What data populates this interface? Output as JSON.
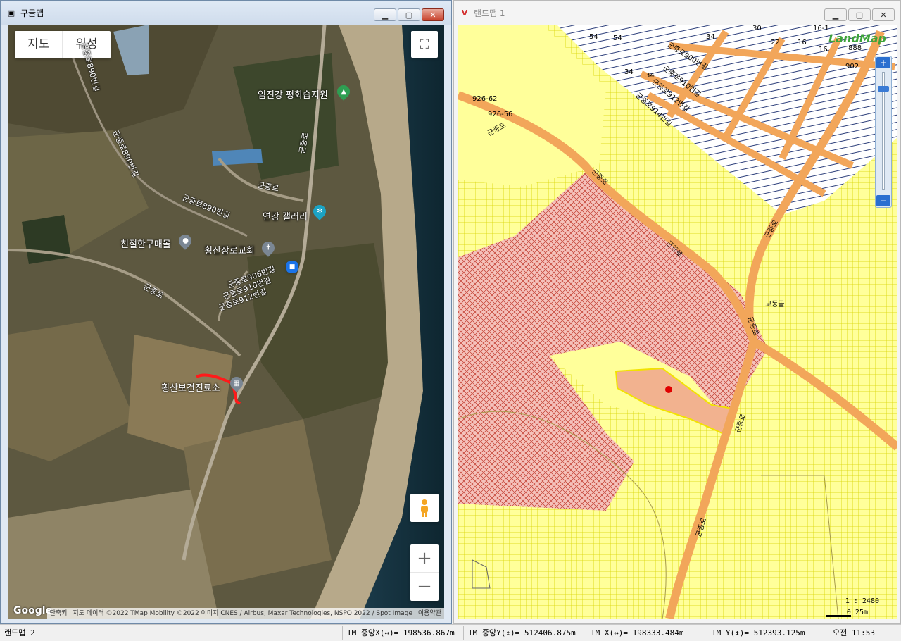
{
  "left_window": {
    "title": "구글맵",
    "controls": {
      "minimize": "▁",
      "maximize": "▢",
      "close": "✕"
    },
    "map_type": {
      "map_label": "지도",
      "satellite_label": "위성"
    },
    "pois": {
      "wetland_park": "임진강 평화습지원",
      "gallery": "연강 갤러리",
      "hanwoo_store": "친절한구매몰",
      "church": "횡산장로교회",
      "health_center": "횡산보건진료소"
    },
    "roads": {
      "r1": "군중로890번길",
      "r2": "군중로890번길",
      "r3": "군중로",
      "r4": "군중로890번길",
      "r5": "군중로",
      "r6": "군중로906번길",
      "r7": "군중로910번길",
      "r8": "군중로912번길",
      "r9": "군중로"
    },
    "footer": {
      "logo": "Google",
      "shortcuts": "단축키",
      "attribution": "지도 데이터 ©2022 TMap Mobility ©2022 이미지 CNES / Airbus, Maxar Technologies, NSPO 2022 / Spot Image",
      "terms": "이용약관"
    }
  },
  "right_window": {
    "title": "랜드맵 1",
    "controls": {
      "minimize": "▁",
      "maximize": "▢",
      "close": "✕"
    },
    "logo": "LandMap",
    "parcel_labels": {
      "p1": "54",
      "p2": "54",
      "p3": "34",
      "p4": "34",
      "p5": "30",
      "p6": "22",
      "p7": "16",
      "p8": "16-1",
      "p9": "16",
      "p10": "902",
      "p11": "926-62",
      "p12": "926-56",
      "p13": "34",
      "p14": "고동골",
      "p15": "888"
    },
    "road_labels": {
      "l1": "군중로900번길",
      "l2": "군중로910번길",
      "l3": "군중로912번길",
      "l4": "군중로914번길",
      "l5": "군중로",
      "l6": "군중로",
      "l7": "군중로",
      "l8": "군중로",
      "l9": "군중로",
      "l10": "군중로",
      "l11": "군중로"
    },
    "scale": {
      "ratio": "1 : 2480",
      "bar_label": "0    25m"
    },
    "zoom": {
      "in": "+",
      "out": "−"
    }
  },
  "statusbar": {
    "app_name": "랜드맵 2",
    "tm_center_x": "TM 중앙X(↔)= 198536.867m",
    "tm_center_y": "TM 중앙Y(↕)= 512406.875m",
    "tm_x": "TM X(↔)= 198333.484m",
    "tm_y": "TM Y(↕)= 512393.125m",
    "clock": "오전 11:53"
  }
}
